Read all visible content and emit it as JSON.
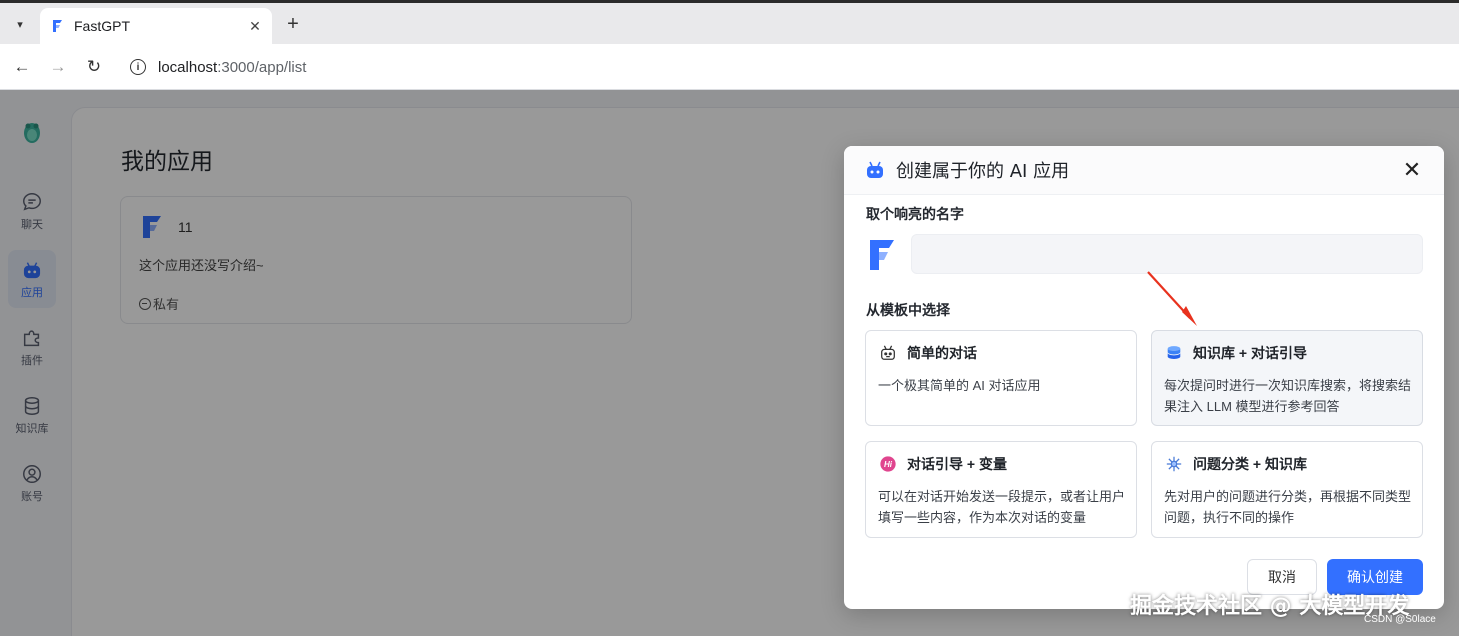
{
  "browser": {
    "tab_title": "FastGPT",
    "url_host": "localhost",
    "url_path": ":3000/app/list"
  },
  "sidebar": {
    "items": [
      {
        "label": "聊天",
        "icon": "chat-icon",
        "active": false
      },
      {
        "label": "应用",
        "icon": "robot-icon",
        "active": true
      },
      {
        "label": "插件",
        "icon": "puzzle-icon",
        "active": false
      },
      {
        "label": "知识库",
        "icon": "database-icon",
        "active": false
      },
      {
        "label": "账号",
        "icon": "user-icon",
        "active": false
      }
    ]
  },
  "main": {
    "title": "我的应用",
    "apps": [
      {
        "name": "11",
        "description": "这个应用还没写介绍~",
        "visibility": "私有"
      }
    ]
  },
  "modal": {
    "title": "创建属于你的 AI 应用",
    "name_label": "取个响亮的名字",
    "name_value": "",
    "template_label": "从模板中选择",
    "templates": [
      {
        "name": "简单的对话",
        "description": "一个极其简单的 AI 对话应用",
        "icon": "bot-face-icon"
      },
      {
        "name": "知识库 + 对话引导",
        "description": "每次提问时进行一次知识库搜索，将搜索结果注入 LLM 模型进行参考回答",
        "icon": "database-stack-icon"
      },
      {
        "name": "对话引导 + 变量",
        "description": "可以在对话开始发送一段提示，或者让用户填写一些内容，作为本次对话的变量",
        "icon": "hi-badge-icon"
      },
      {
        "name": "问题分类 + 知识库",
        "description": "先对用户的问题进行分类，再根据不同类型问题，执行不同的操作",
        "icon": "classify-star-icon"
      }
    ],
    "cancel_label": "取消",
    "confirm_label": "确认创建"
  },
  "watermark": {
    "main": "掘金技术社区 @ 大模型开发",
    "sub": "CSDN @S0lace"
  },
  "colors": {
    "accent": "#3370ff",
    "overlay": "rgba(0,0,0,0.40)",
    "annotation_arrow": "#e8321e"
  }
}
